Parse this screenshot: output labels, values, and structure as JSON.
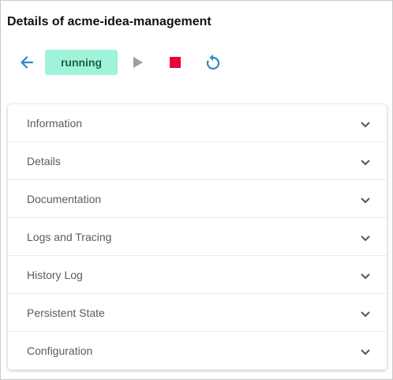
{
  "page": {
    "title": "Details of acme-idea-management"
  },
  "toolbar": {
    "back_icon": "arrow-left-icon",
    "status": "running",
    "status_color": "#9ff3da",
    "play_icon": "play-icon",
    "stop_icon": "stop-icon",
    "restart_icon": "restart-icon",
    "accent_color": "#2a8ac4",
    "stop_color": "#e8003a",
    "play_color": "#9e9e9e"
  },
  "sections": [
    {
      "label": "Information"
    },
    {
      "label": "Details"
    },
    {
      "label": "Documentation"
    },
    {
      "label": "Logs and Tracing"
    },
    {
      "label": "History Log"
    },
    {
      "label": "Persistent State"
    },
    {
      "label": "Configuration"
    }
  ]
}
